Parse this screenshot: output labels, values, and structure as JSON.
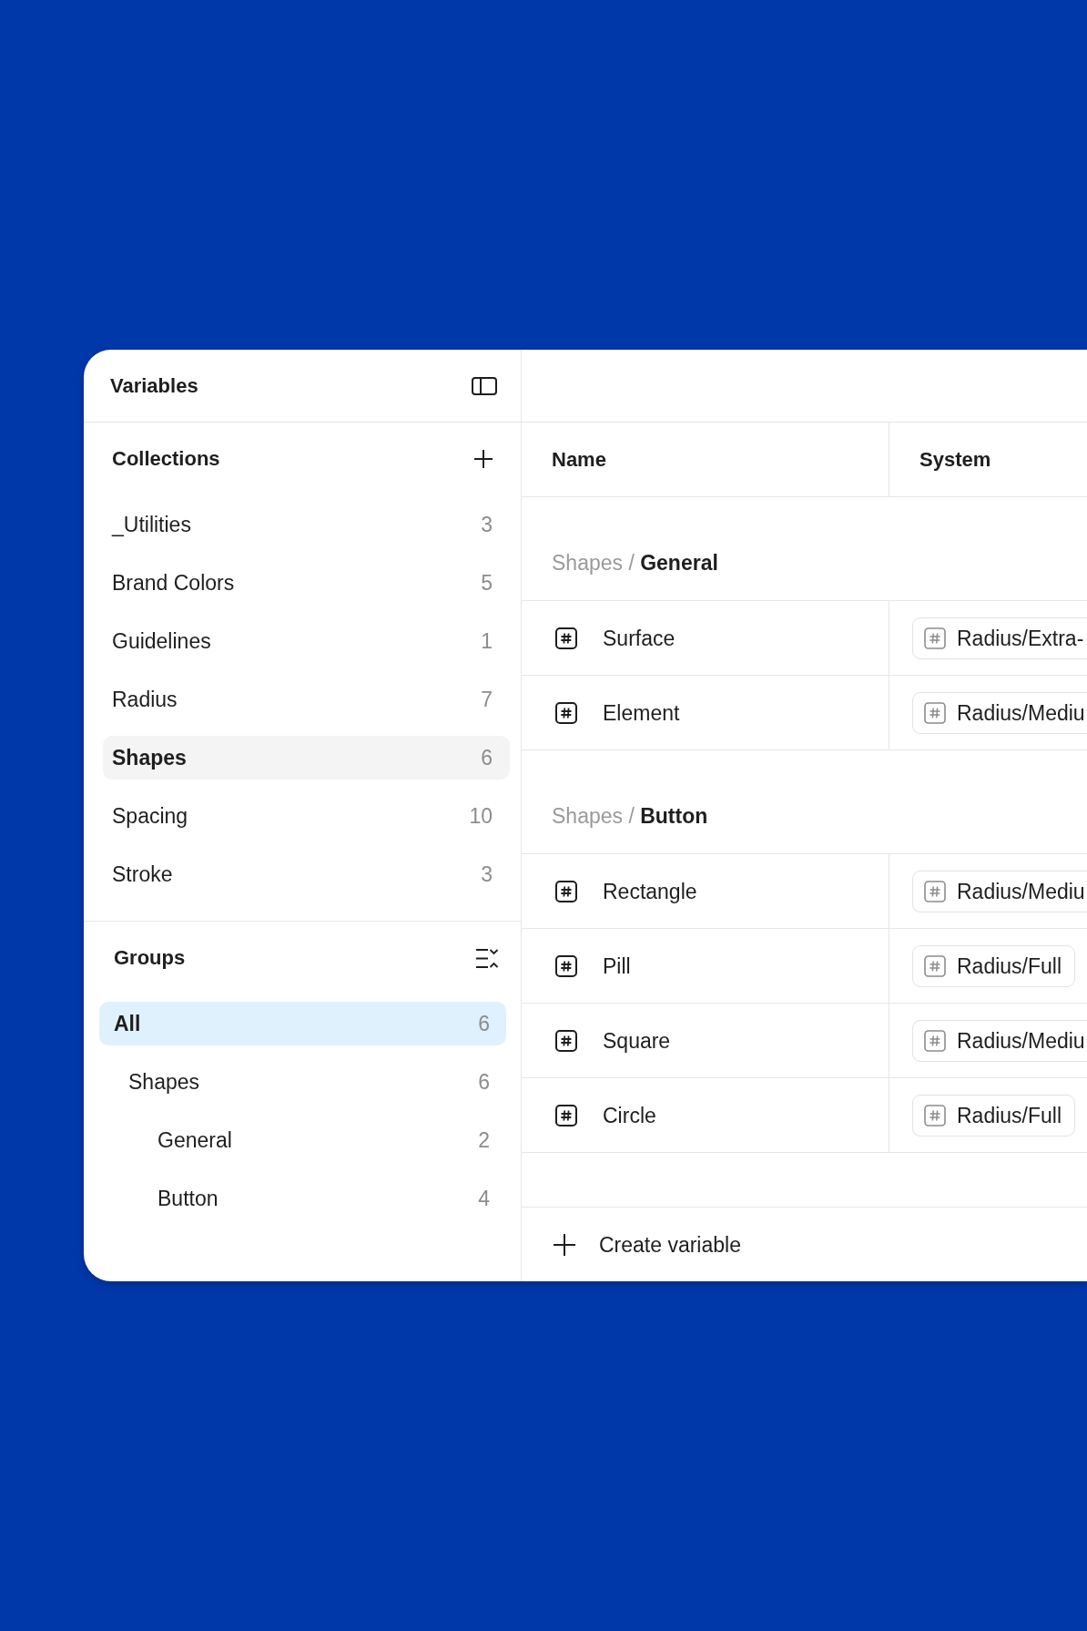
{
  "sidebar": {
    "title": "Variables",
    "collections": {
      "title": "Collections",
      "items": [
        {
          "label": "_Utilities",
          "count": "3",
          "selected": false
        },
        {
          "label": "Brand Colors",
          "count": "5",
          "selected": false
        },
        {
          "label": "Guidelines",
          "count": "1",
          "selected": false
        },
        {
          "label": "Radius",
          "count": "7",
          "selected": false
        },
        {
          "label": "Shapes",
          "count": "6",
          "selected": true
        },
        {
          "label": "Spacing",
          "count": "10",
          "selected": false
        },
        {
          "label": "Stroke",
          "count": "3",
          "selected": false
        }
      ]
    },
    "groups": {
      "title": "Groups",
      "items": [
        {
          "label": "All",
          "count": "6",
          "selected": true,
          "children": [
            {
              "label": "Shapes",
              "count": "6",
              "selected": false,
              "children": [
                {
                  "label": "General",
                  "count": "2",
                  "selected": false
                },
                {
                  "label": "Button",
                  "count": "4",
                  "selected": false
                }
              ]
            }
          ]
        }
      ]
    }
  },
  "table": {
    "columns": [
      "Name",
      "System"
    ],
    "sections": [
      {
        "title": "Shapes / **General**",
        "rows": [
          {
            "name": "Surface",
            "value": "Radius/Extra-"
          },
          {
            "name": "Element",
            "value": "Radius/Mediu"
          }
        ]
      },
      {
        "title": "Shapes / **Button**",
        "rows": [
          {
            "name": "Rectangle",
            "value": "Radius/Mediu"
          },
          {
            "name": "Pill",
            "value": "Radius/Full"
          },
          {
            "name": "Square",
            "value": "Radius/Mediu"
          },
          {
            "name": "Circle",
            "value": "Radius/Full"
          }
        ]
      }
    ],
    "create_button": {
      "label": "Create variable"
    }
  }
}
